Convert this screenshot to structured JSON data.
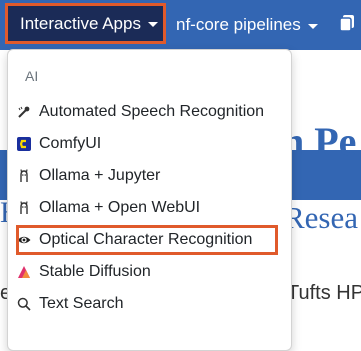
{
  "navbar": {
    "interactive_apps": "Interactive Apps",
    "nfcore": "nf-core pipelines"
  },
  "background": {
    "hero_title": "h Pe",
    "hero_subtitle": "Resea",
    "left_heading": "H",
    "body_text": "Tufts HPC",
    "left_body": "e"
  },
  "dropdown": {
    "header": "AI",
    "items": [
      {
        "label": "Automated Speech Recognition",
        "icon": "speech-recognition-icon"
      },
      {
        "label": "ComfyUI",
        "icon": "comfyui-icon"
      },
      {
        "label": "Ollama + Jupyter",
        "icon": "ollama-icon"
      },
      {
        "label": "Ollama + Open WebUI",
        "icon": "ollama-icon"
      },
      {
        "label": "Optical Character Recognition",
        "icon": "eye-icon"
      },
      {
        "label": "Stable Diffusion",
        "icon": "stable-diffusion-icon"
      },
      {
        "label": "Text Search",
        "icon": "search-icon"
      }
    ]
  },
  "colors": {
    "navbar": "#3366b3",
    "active_nav": "#1b2b57",
    "highlight": "#e05a2b"
  }
}
